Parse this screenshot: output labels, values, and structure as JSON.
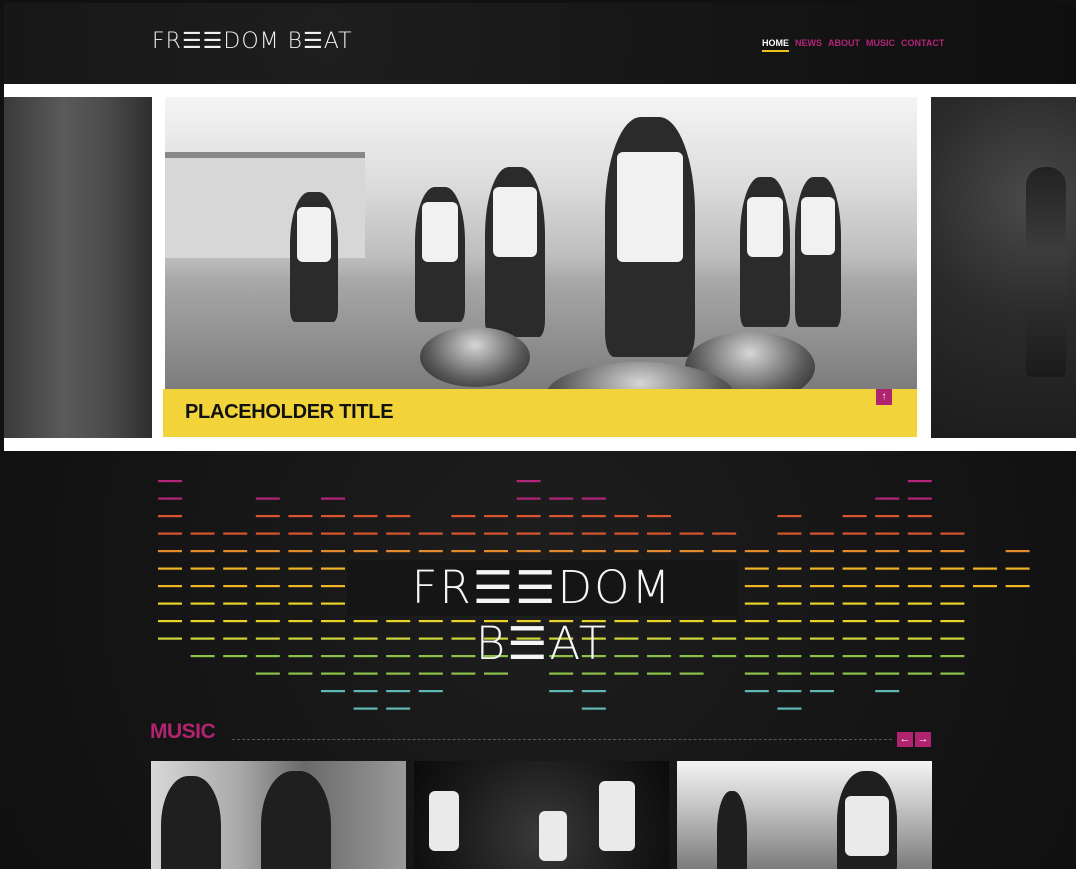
{
  "header": {
    "logo": "FR☰☰DOM B☰AT",
    "nav": [
      {
        "label": "HOME",
        "active": true
      },
      {
        "label": "NEWS",
        "active": false
      },
      {
        "label": "ABOUT",
        "active": false
      },
      {
        "label": "MUSIC",
        "active": false
      },
      {
        "label": "CONTACT",
        "active": false
      }
    ]
  },
  "hero": {
    "caption_title": "PLACEHOLDER TITLE",
    "caption_button_icon": "arrow-up-icon"
  },
  "banner": {
    "title": "FR☰☰DOM B☰AT",
    "equalizer_colors": [
      "#b3247a",
      "#d8552f",
      "#e58a2a",
      "#f0b427",
      "#e9d22a",
      "#cfd63a",
      "#8cc24a",
      "#5fb8b5"
    ]
  },
  "music": {
    "heading": "MUSIC",
    "prev_icon": "arrow-left-icon",
    "next_icon": "arrow-right-icon"
  },
  "colors": {
    "accent_magenta": "#b0246f",
    "accent_yellow": "#f2d43a",
    "background_dark": "#151515"
  }
}
